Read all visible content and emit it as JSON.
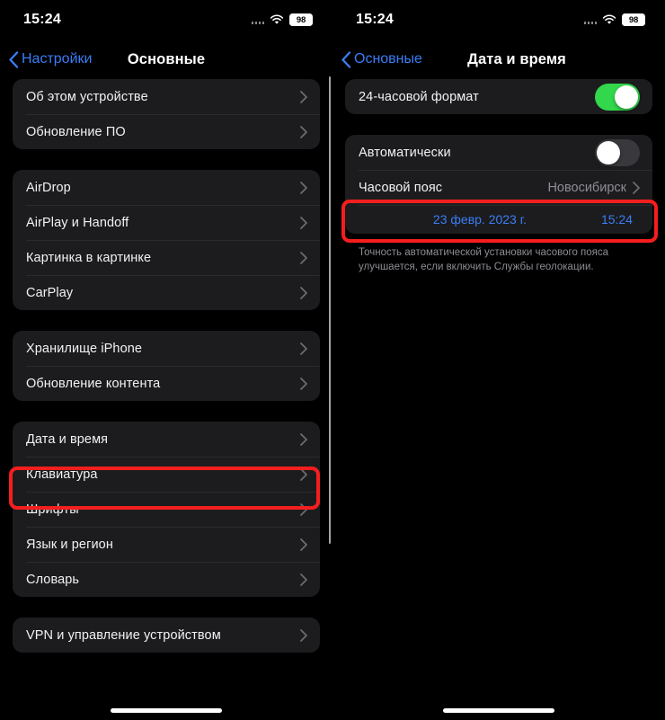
{
  "status_bar": {
    "time": "15:24",
    "battery_level": "98",
    "signal_icon": "signal-dots-icon",
    "wifi_icon": "wifi-icon",
    "battery_icon": "battery-icon"
  },
  "colors": {
    "accent_blue": "#3b7df6",
    "toggle_on_green": "#32d74b",
    "toggle_off_gray": "#39393d",
    "highlight_red": "#f51e1e",
    "card_background": "#1c1c1e",
    "page_background": "#000000",
    "secondary_text": "#8d8d93"
  },
  "left_screen": {
    "nav": {
      "back_label": "Настройки",
      "back_icon": "chevron-left-icon",
      "title": "Основные"
    },
    "groups": [
      {
        "rows": [
          {
            "label": "Об этом устройстве",
            "accessory": "chevron-right-icon"
          },
          {
            "label": "Обновление ПО",
            "accessory": "chevron-right-icon"
          }
        ]
      },
      {
        "rows": [
          {
            "label": "AirDrop",
            "accessory": "chevron-right-icon"
          },
          {
            "label": "AirPlay и Handoff",
            "accessory": "chevron-right-icon"
          },
          {
            "label": "Картинка в картинке",
            "accessory": "chevron-right-icon"
          },
          {
            "label": "CarPlay",
            "accessory": "chevron-right-icon"
          }
        ]
      },
      {
        "rows": [
          {
            "label": "Хранилище iPhone",
            "accessory": "chevron-right-icon"
          },
          {
            "label": "Обновление контента",
            "accessory": "chevron-right-icon"
          }
        ]
      },
      {
        "highlighted_row_index": 0,
        "rows": [
          {
            "label": "Дата и время",
            "accessory": "chevron-right-icon"
          },
          {
            "label": "Клавиатура",
            "accessory": "chevron-right-icon"
          },
          {
            "label": "Шрифты",
            "accessory": "chevron-right-icon"
          },
          {
            "label": "Язык и регион",
            "accessory": "chevron-right-icon"
          },
          {
            "label": "Словарь",
            "accessory": "chevron-right-icon"
          }
        ]
      },
      {
        "rows": [
          {
            "label": "VPN и управление устройством",
            "accessory": "chevron-right-icon"
          }
        ]
      }
    ]
  },
  "right_screen": {
    "nav": {
      "back_label": "Основные",
      "back_icon": "chevron-left-icon",
      "title": "Дата и время"
    },
    "group_format": {
      "rows": [
        {
          "label": "24-часовой формат",
          "toggle": "on"
        }
      ]
    },
    "group_timezone": {
      "rows": [
        {
          "label": "Автоматически",
          "toggle": "off"
        },
        {
          "label": "Часовой пояс",
          "value": "Новосибирск",
          "accessory": "chevron-right-icon",
          "highlighted": true
        }
      ],
      "datetime": {
        "date": "23 февр. 2023 г.",
        "time": "15:24"
      }
    },
    "footnote": "Точность автоматической установки часового пояса улучшается, если включить Службы геолокации."
  }
}
